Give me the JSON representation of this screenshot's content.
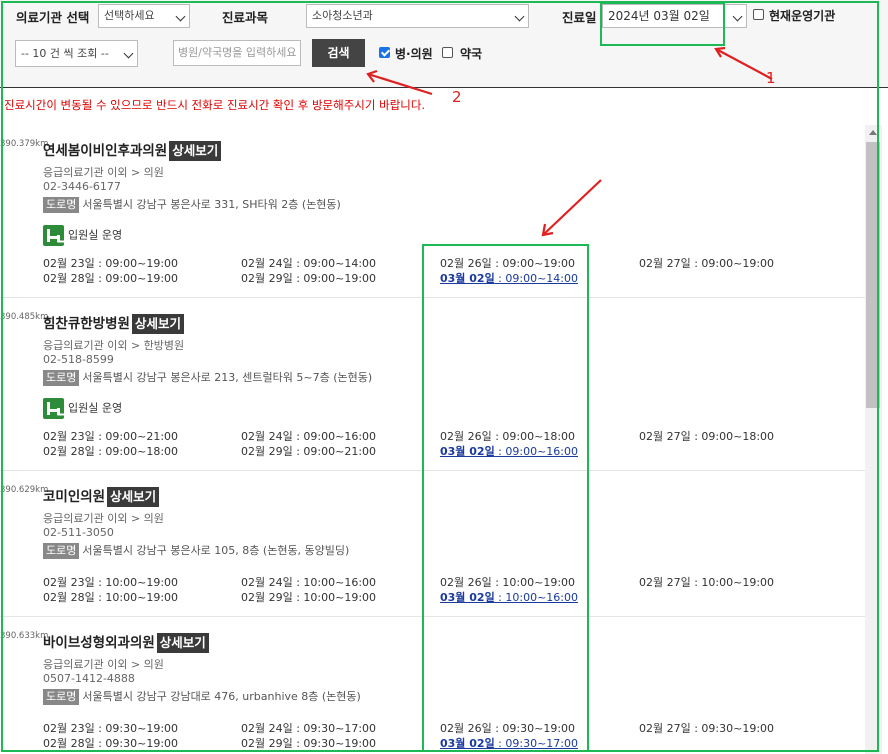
{
  "filters": {
    "institution_label": "의료기관 선택",
    "institution_value": "선택하세요",
    "dept_label": "진료과목",
    "dept_value": "소아청소년과",
    "date_label": "진료일",
    "date_value": "2024년 03월 02일",
    "open_now_label": "현재운영기관",
    "page_size_value": "-- 10 건 씩 조회 --",
    "search_placeholder": "병원/약국명을 입력하세요",
    "search_button": "검색",
    "hospital_label": "병·의원",
    "pharmacy_label": "약국"
  },
  "notice": "진료시간이 변동될 수 있으므로 반드시 전화로 진료시간 확인 후 방문해주시기 바랍니다.",
  "detail_label": "상세보기",
  "road_label": "도로명",
  "ward_label": "입원실 운영",
  "annotations": {
    "label1": "1",
    "label2": "2"
  },
  "items": [
    {
      "distance": "390.379km",
      "name": "연세봄이비인후과의원",
      "category": "응급의료기관 이외 > 의원",
      "phone": "02-3446-6177",
      "address": "서울특별시 강남구 봉은사로 331, SH타워 2층 (논현동)",
      "hours": [
        "02월 23일 : 09:00~19:00",
        "02월 24일 : 09:00~14:00",
        "02월 26일 : 09:00~19:00",
        "02월 27일 : 09:00~19:00",
        "02월 28일 : 09:00~19:00",
        "02월 29일 : 09:00~19:00"
      ],
      "today_date": "03월 02일",
      "today_time": " : 09:00~14:00"
    },
    {
      "distance": "390.485km",
      "name": "힘찬큐한방병원",
      "category": "응급의료기관 이외 > 한방병원",
      "phone": "02-518-8599",
      "address": "서울특별시 강남구 봉은사로 213, 센트럴타워 5~7층 (논현동)",
      "hours": [
        "02월 23일 : 09:00~21:00",
        "02월 24일 : 09:00~16:00",
        "02월 26일 : 09:00~18:00",
        "02월 27일 : 09:00~18:00",
        "02월 28일 : 09:00~18:00",
        "02월 29일 : 09:00~21:00"
      ],
      "today_date": "03월 02일",
      "today_time": " : 09:00~16:00"
    },
    {
      "distance": "390.629km",
      "name": "코미인의원",
      "category": "응급의료기관 이외 > 의원",
      "phone": "02-511-3050",
      "address": "서울특별시 강남구 봉은사로 105, 8층 (논현동, 동양빌딩)",
      "hours": [
        "02월 23일 : 10:00~19:00",
        "02월 24일 : 10:00~16:00",
        "02월 26일 : 10:00~19:00",
        "02월 27일 : 10:00~19:00",
        "02월 28일 : 10:00~19:00",
        "02월 29일 : 10:00~19:00"
      ],
      "today_date": "03월 02일",
      "today_time": " : 10:00~16:00"
    },
    {
      "distance": "390.633km",
      "name": "바이브성형외과의원",
      "category": "응급의료기관 이외 > 의원",
      "phone": "0507-1412-4888",
      "address": "서울특별시 강남구 강남대로 476, urbanhive 8층 (논현동)",
      "hours": [
        "02월 23일 : 09:30~19:00",
        "02월 24일 : 09:30~17:00",
        "02월 26일 : 09:30~19:00",
        "02월 27일 : 09:30~19:00",
        "02월 28일 : 09:30~19:00",
        "02월 29일 : 09:30~19:00"
      ],
      "today_date": "03월 02일",
      "today_time": " : 09:30~17:00"
    }
  ]
}
